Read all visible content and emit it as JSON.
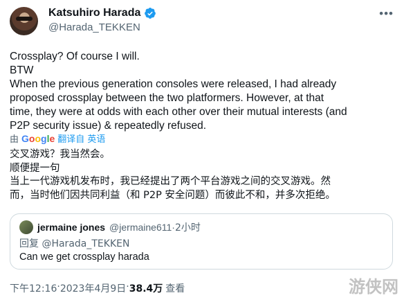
{
  "author": {
    "display_name": "Katsuhiro Harada",
    "handle": "@Harada_TEKKEN"
  },
  "tweet": {
    "lines": [
      "Crossplay? Of course I will.",
      "BTW",
      "When the previous generation consoles were released, I had already",
      "proposed crossplay between the two platformers.  However, at that",
      "time, they were at odds with each other over their mutual interests (and",
      "P2P security issue) & repeatedly refused."
    ]
  },
  "translation": {
    "prefix": "由",
    "provider": "Google",
    "link": "翻译自 英语"
  },
  "translated_text": {
    "lines": [
      "交叉游戏？我当然会。",
      "顺便提一句",
      "当上一代游戏机发布时，我已经提出了两个平台游戏之间的交叉游戏。然",
      "而，当时他们因共同利益（和 P2P 安全问题）而彼此不和，并多次拒绝。"
    ]
  },
  "quote": {
    "name": "jermaine jones",
    "handle": "@jermaine611",
    "separator": " · ",
    "time": "2小时",
    "reply_label": "回复",
    "reply_to": "@Harada_TEKKEN",
    "body": "Can we get crossplay harada"
  },
  "footer": {
    "time": "下午12:16",
    "separator": " · ",
    "date": "2023年4月9日",
    "views": "38.4万",
    "views_label": "查看"
  },
  "watermark": "游侠网",
  "colors": {
    "verified": "#1d9bf0",
    "link": "#1d9bf0",
    "muted": "#536471"
  }
}
